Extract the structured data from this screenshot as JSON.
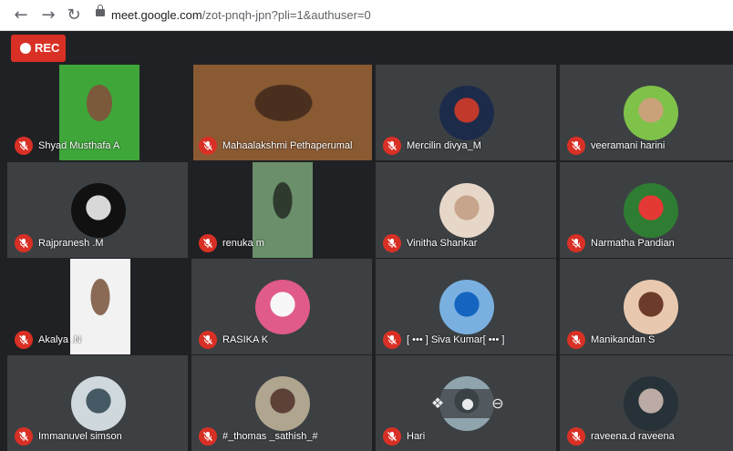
{
  "browser": {
    "url_domain": "meet.google.com",
    "url_rest": "/zot-pnqh-jpn?pli=1&authuser=0"
  },
  "recording": {
    "label": "REC"
  },
  "participants": [
    {
      "name": "Shyad Musthafa A",
      "type": "video",
      "colors": [
        "#3fa63a",
        "#7a5a3a"
      ]
    },
    {
      "name": "Mahaalakshmi Pethaperumal",
      "type": "video",
      "colors": [
        "#8a5a33",
        "#4a2f1f"
      ]
    },
    {
      "name": "Mercilin divya_M",
      "type": "avatar",
      "colors": [
        "#1d2b4a",
        "#c0392b"
      ]
    },
    {
      "name": "veeramani harini",
      "type": "avatar",
      "colors": [
        "#7fc24a",
        "#c9a27a"
      ]
    },
    {
      "name": "Rajpranesh .M",
      "type": "avatar",
      "colors": [
        "#111111",
        "#d8d8d8"
      ]
    },
    {
      "name": "renuka m",
      "type": "video",
      "colors": [
        "#6a8f6a",
        "#2f3a2f"
      ]
    },
    {
      "name": "Vinitha Shankar",
      "type": "avatar",
      "colors": [
        "#e7d7c9",
        "#c7a58c"
      ]
    },
    {
      "name": "Narmatha Pandian",
      "type": "avatar",
      "colors": [
        "#2e7d32",
        "#e53935"
      ]
    },
    {
      "name": "Akalya .N",
      "type": "video",
      "colors": [
        "#f2f2f2",
        "#8a6a55"
      ]
    },
    {
      "name": "RASIKA K",
      "type": "avatar",
      "colors": [
        "#e05a8a",
        "#f7f7f7"
      ]
    },
    {
      "name": "[ ••• ] Siva Kumar[ ••• ]",
      "type": "avatar",
      "colors": [
        "#7ab0e0",
        "#1565c0"
      ]
    },
    {
      "name": "Manikandan S",
      "type": "avatar",
      "colors": [
        "#e8c9b0",
        "#6d3b2a"
      ]
    },
    {
      "name": "Immanuvel simson",
      "type": "avatar",
      "colors": [
        "#cfd8dc",
        "#455a64"
      ]
    },
    {
      "name": "#_thomas _sathish_#",
      "type": "avatar",
      "colors": [
        "#b0a58f",
        "#5d4037"
      ]
    },
    {
      "name": "Hari",
      "type": "avatar",
      "colors": [
        "#90a4ae",
        "#37474f"
      ]
    },
    {
      "name": "raveena.d raveena",
      "type": "avatar",
      "colors": [
        "#263238",
        "#bcaaa4"
      ]
    }
  ]
}
